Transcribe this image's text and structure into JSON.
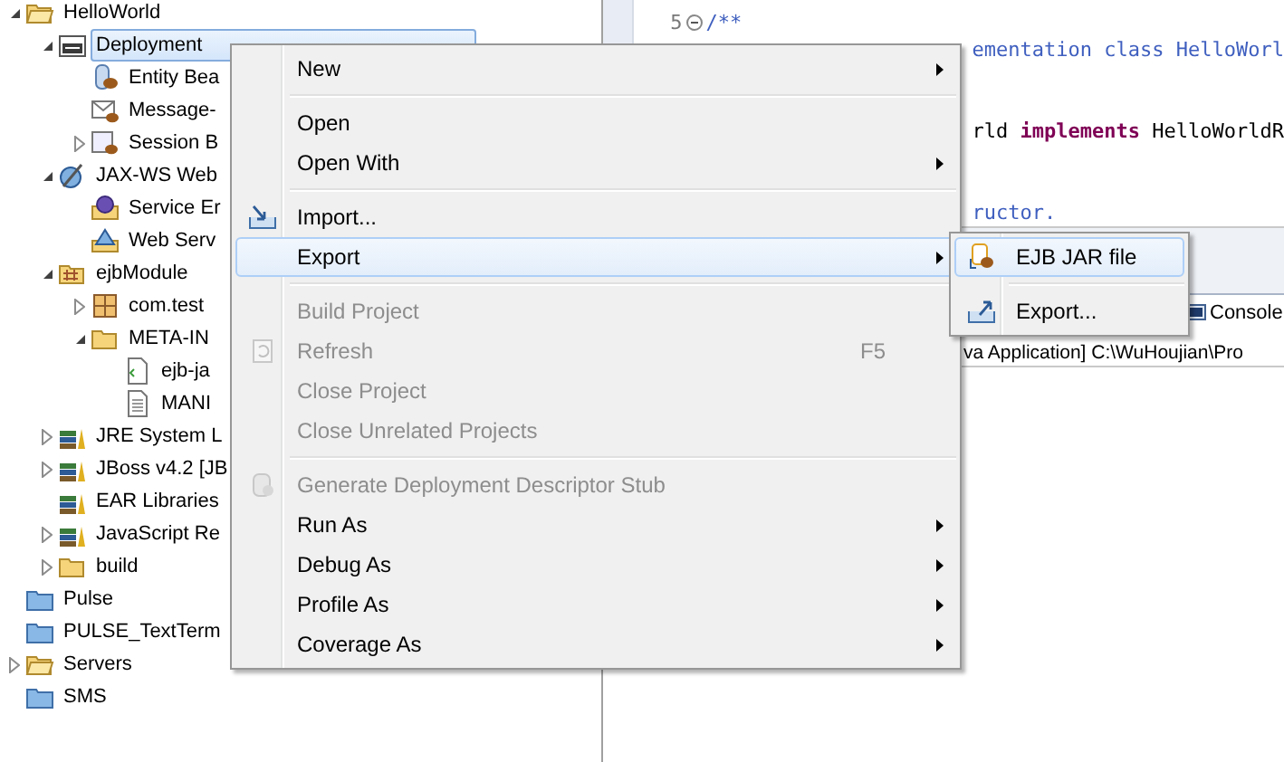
{
  "tree": [
    {
      "label": "HelloWorld",
      "kind": "project",
      "expanded": true,
      "selected": false,
      "children": [
        {
          "label": "Deployment",
          "kind": "descriptor",
          "expanded": true,
          "selected": true,
          "children": [
            {
              "label": "Entity Bea",
              "kind": "entity",
              "selected": false
            },
            {
              "label": "Message-",
              "kind": "message",
              "selected": false
            },
            {
              "label": "Session B",
              "kind": "session",
              "expanded": false,
              "selected": false
            }
          ]
        },
        {
          "label": "JAX-WS Web",
          "kind": "webservices",
          "expanded": true,
          "selected": false,
          "children": [
            {
              "label": "Service Er",
              "kind": "endpoint",
              "selected": false
            },
            {
              "label": "Web Serv",
              "kind": "client",
              "selected": false
            }
          ]
        },
        {
          "label": "ejbModule",
          "kind": "source",
          "expanded": true,
          "selected": false,
          "children": [
            {
              "label": "com.test",
              "kind": "package",
              "expanded": false,
              "selected": false
            },
            {
              "label": "META-IN",
              "kind": "folder",
              "expanded": true,
              "selected": false,
              "children": [
                {
                  "label": "ejb-ja",
                  "kind": "xml",
                  "selected": false
                },
                {
                  "label": "MANI",
                  "kind": "file",
                  "selected": false
                }
              ]
            }
          ]
        },
        {
          "label": "JRE System L",
          "kind": "library",
          "expanded": false,
          "selected": false
        },
        {
          "label": "JBoss v4.2 [JB",
          "kind": "library",
          "expanded": false,
          "selected": false
        },
        {
          "label": "EAR Libraries",
          "kind": "library",
          "selected": false
        },
        {
          "label": "JavaScript Re",
          "kind": "library",
          "expanded": false,
          "selected": false
        },
        {
          "label": "build",
          "kind": "folder",
          "expanded": false,
          "selected": false
        }
      ]
    },
    {
      "label": "Pulse",
      "kind": "closed",
      "selected": false
    },
    {
      "label": "PULSE_TextTerm",
      "kind": "closed",
      "selected": false
    },
    {
      "label": "Servers",
      "kind": "project",
      "expanded": false,
      "selected": false
    },
    {
      "label": "SMS",
      "kind": "closed",
      "selected": false
    }
  ],
  "editor": {
    "lines": [
      {
        "kind": "full",
        "number": "5",
        "fold": true,
        "segments": [
          {
            "text": "/**",
            "kind": "doc"
          }
        ]
      },
      {
        "kind": "fragment",
        "segments": [
          {
            "text": "ementation class HelloWorl",
            "kind": "doc"
          }
        ]
      },
      {
        "kind": "blank"
      },
      {
        "kind": "blank"
      },
      {
        "kind": "fragment",
        "segments": [
          {
            "text": "rld ",
            "kind": "plain"
          },
          {
            "text": "implements",
            "kind": "keyword"
          },
          {
            "text": " HelloWorldR",
            "kind": "plain"
          }
        ]
      },
      {
        "kind": "blank"
      },
      {
        "kind": "blank"
      },
      {
        "kind": "fragment",
        "segments": [
          {
            "text": "ructor.",
            "kind": "doc"
          }
        ]
      }
    ]
  },
  "console": {
    "tab": "Console",
    "line": "va Application] C:\\WuHoujian\\Pro"
  },
  "menu": {
    "items": [
      {
        "kind": "plain",
        "label": "New",
        "submenu": true,
        "disabled": false,
        "selected": false
      },
      {
        "kind": "separator"
      },
      {
        "kind": "plain",
        "label": "Open",
        "submenu": false,
        "disabled": false,
        "selected": false
      },
      {
        "kind": "plain",
        "label": "Open With",
        "submenu": true,
        "disabled": false,
        "selected": false
      },
      {
        "kind": "separator"
      },
      {
        "kind": "import",
        "label": "Import...",
        "submenu": false,
        "disabled": false,
        "selected": false
      },
      {
        "kind": "plain",
        "label": "Export",
        "submenu": true,
        "disabled": false,
        "selected": true
      },
      {
        "kind": "separator"
      },
      {
        "kind": "plain",
        "label": "Build Project",
        "submenu": false,
        "disabled": true,
        "selected": false
      },
      {
        "kind": "refresh",
        "label": "Refresh",
        "shortcut": "F5",
        "submenu": false,
        "disabled": true,
        "selected": false
      },
      {
        "kind": "plain",
        "label": "Close Project",
        "submenu": false,
        "disabled": true,
        "selected": false
      },
      {
        "kind": "plain",
        "label": "Close Unrelated Projects",
        "submenu": false,
        "disabled": true,
        "selected": false
      },
      {
        "kind": "separator"
      },
      {
        "kind": "stub",
        "label": "Generate Deployment Descriptor Stub",
        "submenu": false,
        "disabled": true,
        "selected": false
      },
      {
        "kind": "plain",
        "label": "Run As",
        "submenu": true,
        "disabled": false,
        "selected": false
      },
      {
        "kind": "plain",
        "label": "Debug As",
        "submenu": true,
        "disabled": false,
        "selected": false
      },
      {
        "kind": "plain",
        "label": "Profile As",
        "submenu": true,
        "disabled": false,
        "selected": false
      },
      {
        "kind": "plain",
        "label": "Coverage As",
        "submenu": true,
        "disabled": false,
        "selected": false
      }
    ]
  },
  "submenu": {
    "items": [
      {
        "kind": "jar",
        "label": "EJB JAR file",
        "submenu": false,
        "disabled": false,
        "selected": true
      },
      {
        "kind": "separator"
      },
      {
        "kind": "export",
        "label": "Export...",
        "submenu": false,
        "disabled": false,
        "selected": false
      }
    ]
  }
}
